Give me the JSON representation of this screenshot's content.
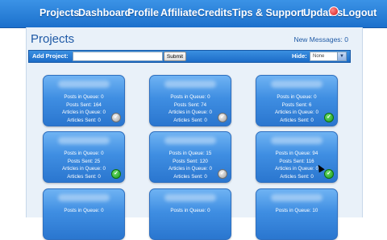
{
  "nav": {
    "items": [
      "Projects",
      "Dashboard",
      "Profile",
      "Affiliate",
      "Credits",
      "Tips & Support",
      "Updates",
      "Logout"
    ]
  },
  "page": {
    "title": "Projects",
    "new_messages": "New Messages: 0"
  },
  "add_bar": {
    "add_label": "Add Project:",
    "input_value": "",
    "submit_label": "Submit",
    "hide_label": "Hide:",
    "hide_selected": "None"
  },
  "cards": [
    {
      "posts_in_queue": "Posts in Queue: 0",
      "posts_sent": "Posts Sent: 164",
      "articles_in_queue": "Articles in Queue: 0",
      "articles_sent": "Articles Sent: 0",
      "status": "pending"
    },
    {
      "posts_in_queue": "Posts in Queue: 0",
      "posts_sent": "Posts Sent: 74",
      "articles_in_queue": "Articles in Queue: 0",
      "articles_sent": "Articles Sent: 0",
      "status": "pending"
    },
    {
      "posts_in_queue": "Posts in Queue: 0",
      "posts_sent": "Posts Sent: 6",
      "articles_in_queue": "Articles in Queue: 0",
      "articles_sent": "Articles Sent: 0",
      "status": "ok"
    },
    {
      "posts_in_queue": "Posts in Queue: 0",
      "posts_sent": "Posts Sent: 25",
      "articles_in_queue": "Articles in Queue: 0",
      "articles_sent": "Articles Sent: 0",
      "status": "ok"
    },
    {
      "posts_in_queue": "Posts in Queue: 15",
      "posts_sent": "Posts Sent: 120",
      "articles_in_queue": "Articles in Queue: 0",
      "articles_sent": "Articles Sent: 0",
      "status": "pending"
    },
    {
      "posts_in_queue": "Posts in Queue: 94",
      "posts_sent": "Posts Sent: 116",
      "articles_in_queue": "Articles in Queue: 0",
      "articles_sent": "Articles Sent: 0",
      "status": "ok"
    },
    {
      "posts_in_queue": "Posts in Queue: 0",
      "status": ""
    },
    {
      "posts_in_queue": "Posts in Queue: 0",
      "status": ""
    },
    {
      "posts_in_queue": "Posts in Queue: 10",
      "status": ""
    }
  ],
  "colors": {
    "nav_bg": "#1c70cc",
    "card_bg": "#3f8ee2",
    "title": "#1f5aa6",
    "ok": "#1a9a1a",
    "pending": "#9d9d9d"
  },
  "icons": {
    "ok": "check-circle-icon",
    "pending": "check-circle-gray-icon",
    "updates_badge": "notification-badge-icon",
    "cursor": "mouse-pointer-icon"
  }
}
